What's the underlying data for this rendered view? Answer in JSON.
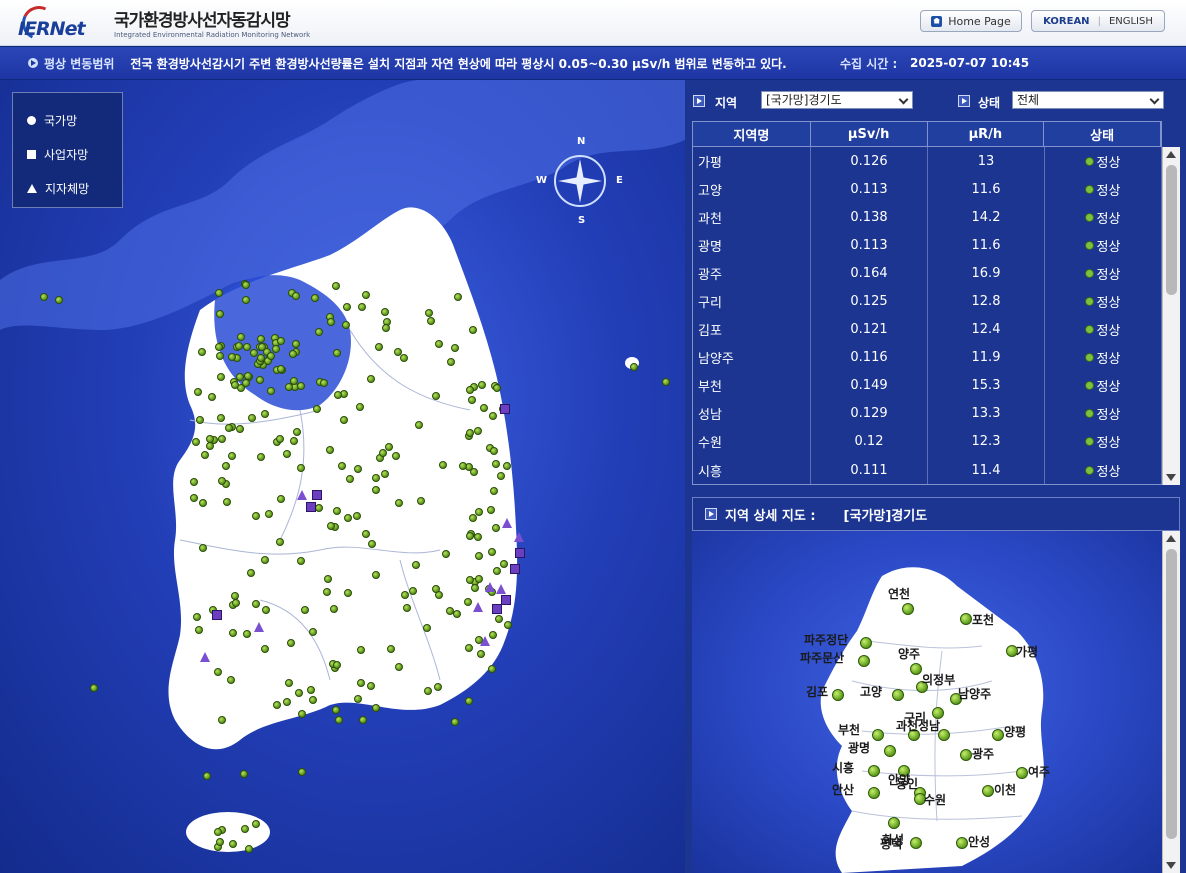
{
  "header": {
    "logo_text": "IERNet",
    "title_kr": "국가환경방사선자동감시망",
    "title_en": "Integrated Environmental Radiation Monitoring Network",
    "home_button": "Home Page",
    "lang_korean": "KOREAN",
    "lang_english": "ENGLISH"
  },
  "infobar": {
    "label": "평상 변동범위",
    "message": "전국 환경방사선감시기 주변 환경방사선량률은 설치 지점과 자연 현상에 따라 평상시 0.05~0.30 μSv/h 범위로 변동하고 있다.",
    "time_label": "수집 시간 :",
    "time_value": "2025-07-07  10:45"
  },
  "legend": {
    "national": "국가망",
    "business": "사업자망",
    "local": "지자체망"
  },
  "compass": {
    "n": "N",
    "s": "S",
    "e": "E",
    "w": "W"
  },
  "filters": {
    "region_label": "지역",
    "region_value": "[국가망]경기도",
    "status_label": "상태",
    "status_value": "전체"
  },
  "table": {
    "headers": [
      "지역명",
      "μSv/h",
      "μR/h",
      "상태"
    ],
    "rows": [
      {
        "name": "가평",
        "usv": "0.126",
        "ur": "13",
        "status": "정상"
      },
      {
        "name": "고양",
        "usv": "0.113",
        "ur": "11.6",
        "status": "정상"
      },
      {
        "name": "과천",
        "usv": "0.138",
        "ur": "14.2",
        "status": "정상"
      },
      {
        "name": "광명",
        "usv": "0.113",
        "ur": "11.6",
        "status": "정상"
      },
      {
        "name": "광주",
        "usv": "0.164",
        "ur": "16.9",
        "status": "정상"
      },
      {
        "name": "구리",
        "usv": "0.125",
        "ur": "12.8",
        "status": "정상"
      },
      {
        "name": "김포",
        "usv": "0.121",
        "ur": "12.4",
        "status": "정상"
      },
      {
        "name": "남양주",
        "usv": "0.116",
        "ur": "11.9",
        "status": "정상"
      },
      {
        "name": "부천",
        "usv": "0.149",
        "ur": "15.3",
        "status": "정상"
      },
      {
        "name": "성남",
        "usv": "0.129",
        "ur": "13.3",
        "status": "정상"
      },
      {
        "name": "수원",
        "usv": "0.12",
        "ur": "12.3",
        "status": "정상"
      },
      {
        "name": "시흥",
        "usv": "0.111",
        "ur": "11.4",
        "status": "정상"
      }
    ]
  },
  "detail": {
    "label": "지역 상세 지도 :",
    "region": "[국가망]경기도",
    "sites": [
      "연천",
      "포천",
      "파주정단",
      "파주문산",
      "양주",
      "가평",
      "고양",
      "의정부",
      "김포",
      "남양주",
      "구리",
      "부천",
      "과천",
      "성남",
      "양평",
      "광명",
      "광주",
      "시흥",
      "안양",
      "여주",
      "용인",
      "안산",
      "수원",
      "이천",
      "화성",
      "평택",
      "안성"
    ]
  },
  "colors": {
    "map_sea": "#233fb8",
    "land": "#ffffff",
    "station_dot": "#7cc040",
    "business_marker": "#6b3fc0",
    "panel": "#1b3590"
  }
}
